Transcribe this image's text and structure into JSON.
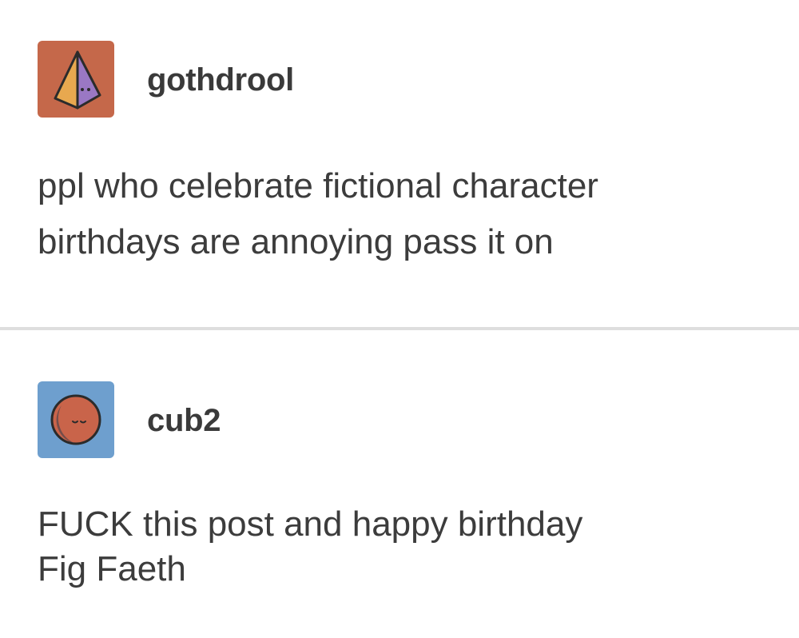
{
  "posts": [
    {
      "username": "gothdrool",
      "avatar_icon": "pyramid-face-icon",
      "avatar_colors": {
        "background": "#c5684a",
        "left_face": "#e8a84f",
        "right_face": "#9a78c4",
        "outline": "#2b2b2b"
      },
      "body_lines": [
        "ppl who celebrate fictional character",
        "birthdays are annoying pass it on"
      ]
    },
    {
      "username": "cub2",
      "avatar_icon": "sleeping-moon-face-icon",
      "avatar_colors": {
        "background": "#6e9fce",
        "face": "#c9644a",
        "outline": "#2b2b2b"
      },
      "body_lines": [
        "FUCK this post and happy birthday",
        "Fig Faeth"
      ]
    }
  ]
}
